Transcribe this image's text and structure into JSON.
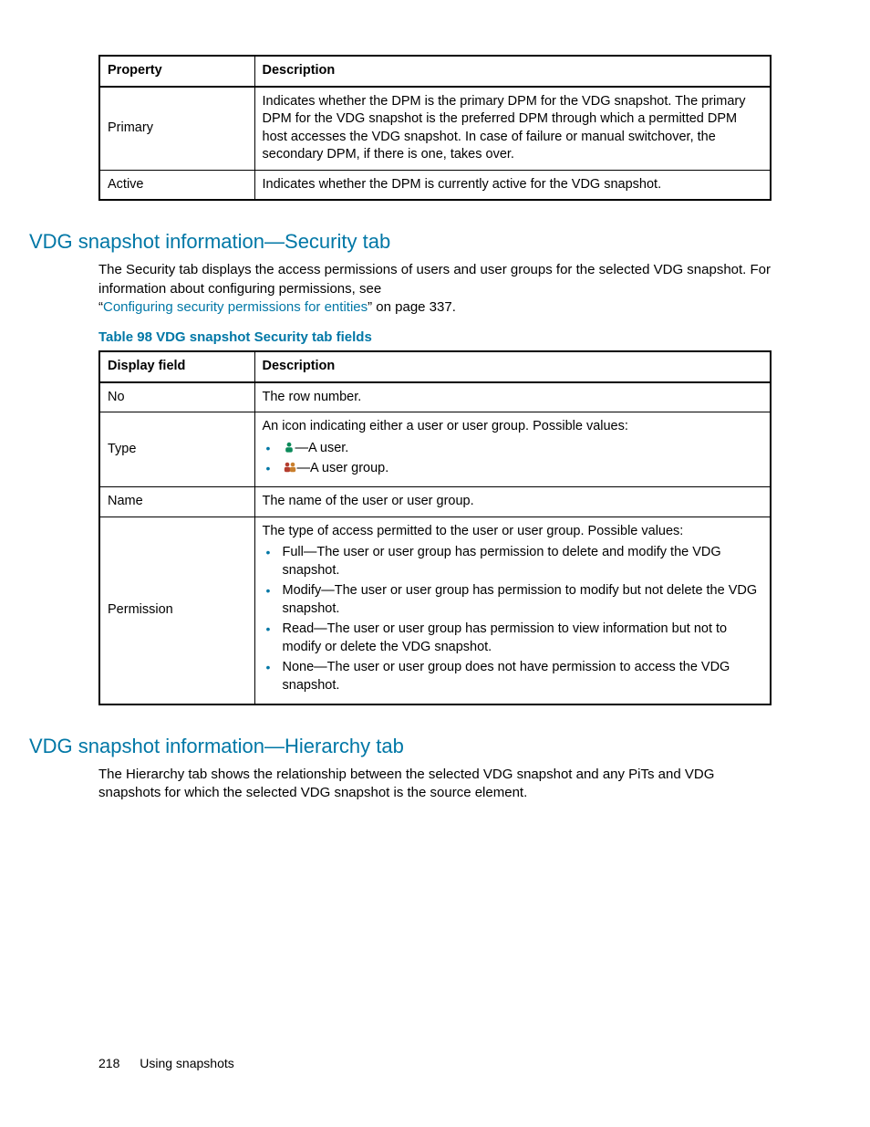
{
  "table1": {
    "head": {
      "c1": "Property",
      "c2": "Description"
    },
    "rows": [
      {
        "c1": "Primary",
        "c2": "Indicates whether the DPM is the primary DPM for the VDG snapshot. The primary DPM for the VDG snapshot is the preferred DPM through which a permitted DPM host accesses the VDG snapshot. In case of failure or manual switchover, the secondary DPM, if there is one, takes over."
      },
      {
        "c1": "Active",
        "c2": "Indicates whether the DPM is currently active for the VDG snapshot."
      }
    ]
  },
  "sec_security": {
    "heading": "VDG snapshot information—Security tab",
    "para1": "The Security tab displays the access permissions of users and user groups for the selected VDG snapshot. For information about configuring permissions, see",
    "link_pre": "“",
    "link_text": "Configuring security permissions for entities",
    "link_post": "” on page 337."
  },
  "tcaption": "Table 98 VDG snapshot Security tab fields",
  "table2": {
    "head": {
      "c1": "Display field",
      "c2": "Description"
    },
    "r_no": {
      "c1": "No",
      "c2": "The row number."
    },
    "r_type": {
      "c1": "Type",
      "lead": "An icon indicating either a user or user group. Possible values:",
      "b1": "—A user.",
      "b2": "—A user group."
    },
    "r_name": {
      "c1": "Name",
      "c2": "The name of the user or user group."
    },
    "r_perm": {
      "c1": "Permission",
      "lead": "The type of access permitted to the user or user group. Possible values:",
      "b1": "Full—The user or user group has permission to delete and modify the VDG snapshot.",
      "b2": "Modify—The user or user group has permission to modify but not delete the VDG snapshot.",
      "b3": "Read—The user or user group has permission to view information but not to modify or delete the VDG snapshot.",
      "b4": "None—The user or user group does not have permission to access the VDG snapshot."
    }
  },
  "sec_hierarchy": {
    "heading": "VDG snapshot information—Hierarchy tab",
    "para": "The Hierarchy tab shows the relationship between the selected VDG snapshot and any PiTs and VDG snapshots for which the selected VDG snapshot is the source element."
  },
  "footer": {
    "page": "218",
    "title": "Using snapshots"
  }
}
